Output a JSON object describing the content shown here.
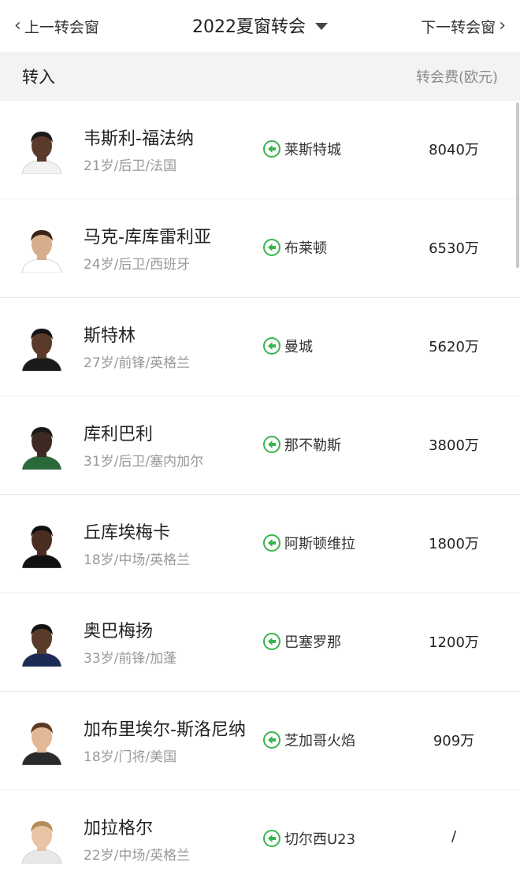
{
  "header": {
    "prev_label": "上一转会窗",
    "title": "2022夏窗转会",
    "next_label": "下一转会窗"
  },
  "section": {
    "title": "转入",
    "fee_header": "转会费(欧元)"
  },
  "colors": {
    "accent_green": "#39b54a",
    "section_bg": "#f2f3f5",
    "muted_text": "#999999"
  },
  "players": [
    {
      "name": "韦斯利-福法纳",
      "meta": "21岁/后卫/法国",
      "club": "莱斯特城",
      "fee": "8040万",
      "icon": "arrow-left-icon",
      "skin": "#5a3a2a",
      "hair": "#1a1a1a",
      "shirt": "#f2f2f2"
    },
    {
      "name": "马克-库库雷利亚",
      "meta": "24岁/后卫/西班牙",
      "club": "布莱顿",
      "fee": "6530万",
      "icon": "arrow-left-icon",
      "skin": "#d7ae8c",
      "hair": "#3a2418",
      "shirt": "#ffffff"
    },
    {
      "name": "斯特林",
      "meta": "27岁/前锋/英格兰",
      "club": "曼城",
      "fee": "5620万",
      "icon": "arrow-left-icon",
      "skin": "#5b3a2a",
      "hair": "#141414",
      "shirt": "#1a1a1a"
    },
    {
      "name": "库利巴利",
      "meta": "31岁/后卫/塞内加尔",
      "club": "那不勒斯",
      "fee": "3800万",
      "icon": "arrow-left-icon",
      "skin": "#3e2a22",
      "hair": "#1a1a1a",
      "shirt": "#2a6a3a"
    },
    {
      "name": "丘库埃梅卡",
      "meta": "18岁/中场/英格兰",
      "club": "阿斯顿维拉",
      "fee": "1800万",
      "icon": "arrow-left-icon",
      "skin": "#4a2e22",
      "hair": "#111111",
      "shirt": "#111111"
    },
    {
      "name": "奥巴梅扬",
      "meta": "33岁/前锋/加蓬",
      "club": "巴塞罗那",
      "fee": "1200万",
      "icon": "arrow-left-icon",
      "skin": "#5a3a28",
      "hair": "#111111",
      "shirt": "#1b2b55"
    },
    {
      "name": "加布里埃尔-斯洛尼纳",
      "meta": "18岁/门将/美国",
      "club": "芝加哥火焰",
      "fee": "909万",
      "icon": "arrow-left-icon",
      "skin": "#e2b896",
      "hair": "#5a3a22",
      "shirt": "#2a2a2a"
    },
    {
      "name": "加拉格尔",
      "meta": "22岁/中场/英格兰",
      "club": "切尔西U23",
      "fee": "/",
      "icon": "arrow-left-icon",
      "skin": "#e8c3a4",
      "hair": "#b58a55",
      "shirt": "#e8e8e8"
    }
  ]
}
